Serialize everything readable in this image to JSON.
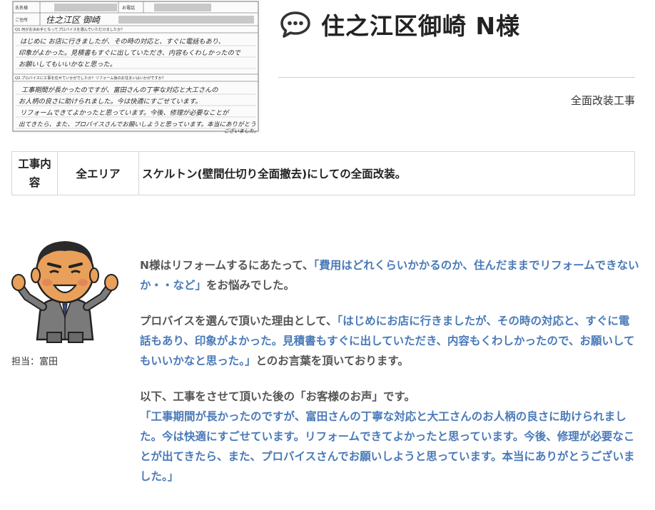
{
  "scan": {
    "row1_left": "氏名様",
    "row1_right": "お電話",
    "row2_label": "ご住所",
    "row2_hand": "住之江区 御崎",
    "q1_label": "Q1.何がお決め手となってプロバイスを選んでいただけましたか？",
    "q1_hand": [
      "はじめに お店に行きましたが、その時の対応と、すぐに電話もあり、",
      "印象がよかった。見積書もすぐに出していただき、内容もくわしかったので",
      "お願いしてもいいかなと思った。"
    ],
    "q2_label": "Q2.プロバイスに工事を任せていかがでしたか？リフォーム後のお住まいはいかがですか？",
    "q2_hand": [
      "工事期間が長かったのですが、富田さんの丁寧な対応と大工さんの",
      "お人柄の良さに助けられました。今は快適にすごせています。",
      "リフォームできてよかったと思っています。今後、修理が必要なことが",
      "出てきたら、また、プロバイスさんでお願いしようと思っています。本当にありがとう",
      "ございました。"
    ]
  },
  "header": {
    "title": "住之江区御崎 N様",
    "category": "全面改装工事",
    "icon": "speech-bubble-icon"
  },
  "work": {
    "label": "工事内容",
    "area": "全エリア",
    "description": "スケルトン(壁間仕切り全面撤去)にしての全面改装。"
  },
  "staff": {
    "label": "担当：富田",
    "icon": "staff-illustration"
  },
  "body": {
    "p1_a": "N様はリフォームするにあたって、",
    "p1_q": "「費用はどれくらいかかるのか、住んだままでリフォームできないか・・など」",
    "p1_b": "をお悩みでした。",
    "p2_a": "プロバイスを選んで頂いた理由として、",
    "p2_q": "「はじめにお店に行きましたが、その時の対応と、すぐに電話もあり、印象がよかった。見積書もすぐに出していただき、内容もくわしかったので、お願いしてもいいかなと思った。」",
    "p2_b": "とのお言葉を頂いております。",
    "p3_a": "以下、工事をさせて頂いた後の「お客様のお声」です。",
    "p3_q": "「工事期間が長かったのですが、富田さんの丁寧な対応と大工さんのお人柄の良さに助けられました。今は快適にすごせています。リフォームできてよかったと思っています。今後、修理が必要なことが出てきたら、また、プロバイスさんでお願いしようと思っています。本当にありがとうございました。」"
  },
  "colors": {
    "quote": "#4a7ab8",
    "text": "#555555",
    "title": "#222222"
  }
}
